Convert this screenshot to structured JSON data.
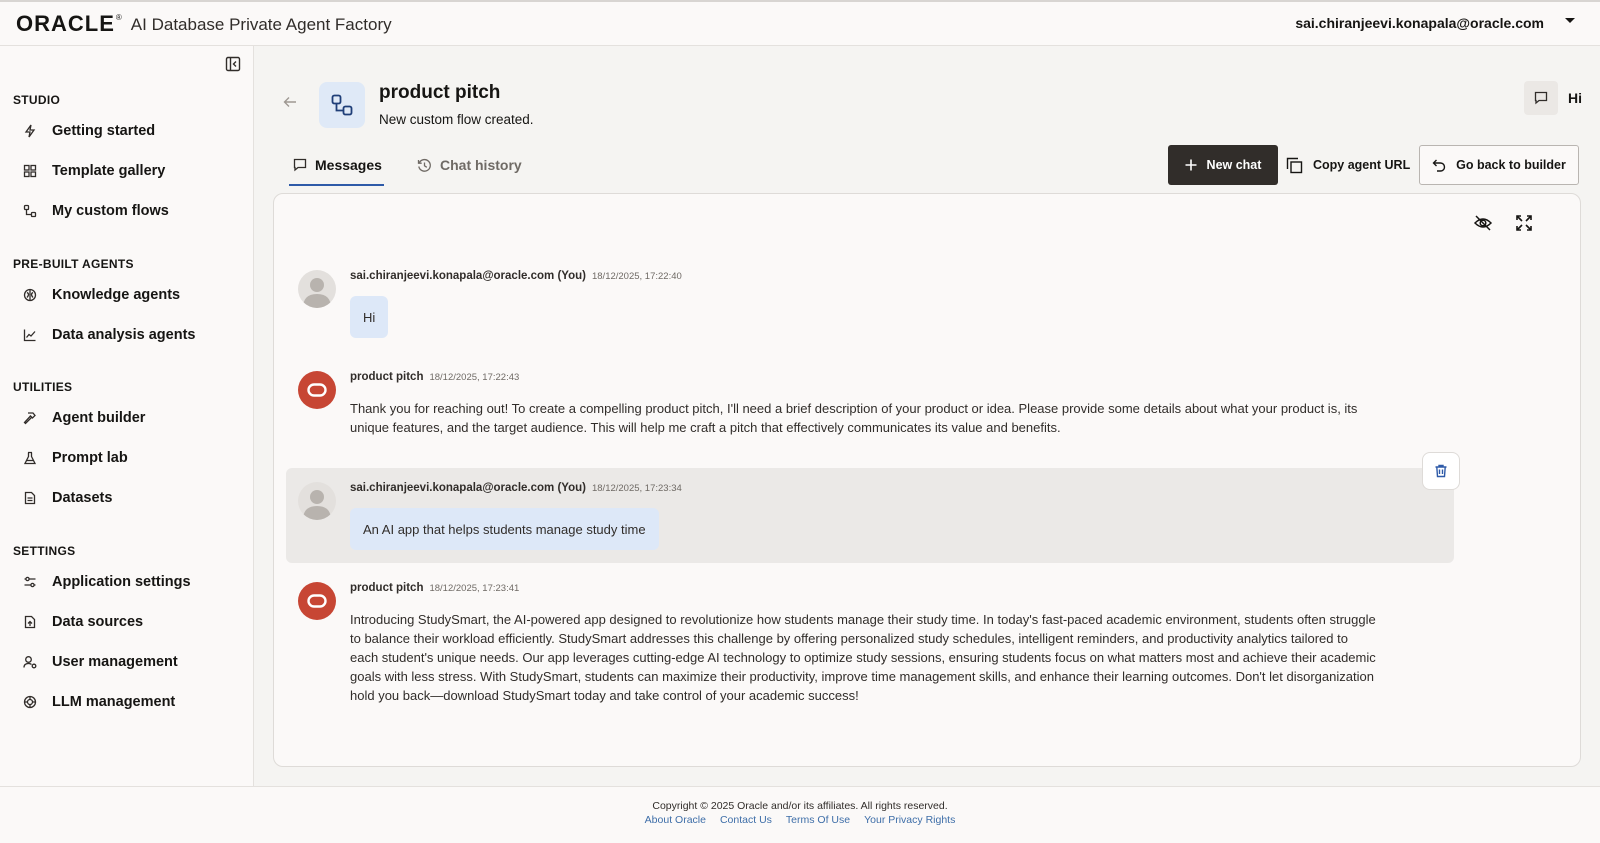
{
  "header": {
    "logo_text": "ORACLE",
    "logo_mark": "®",
    "product_name": "AI Database Private Agent Factory",
    "user_email": "sai.chiranjeevi.konapala@oracle.com"
  },
  "sidebar": {
    "sections": [
      {
        "title": "STUDIO",
        "items": [
          {
            "label": "Getting started",
            "icon": "bolt-icon"
          },
          {
            "label": "Template gallery",
            "icon": "grid-icon"
          },
          {
            "label": "My custom flows",
            "icon": "flow-icon"
          }
        ]
      },
      {
        "title": "PRE-BUILT AGENTS",
        "items": [
          {
            "label": "Knowledge agents",
            "icon": "brain-icon"
          },
          {
            "label": "Data analysis agents",
            "icon": "chart-line-icon"
          }
        ]
      },
      {
        "title": "UTILITIES",
        "items": [
          {
            "label": "Agent builder",
            "icon": "hammer-icon"
          },
          {
            "label": "Prompt lab",
            "icon": "flask-icon"
          },
          {
            "label": "Datasets",
            "icon": "document-icon"
          }
        ]
      },
      {
        "title": "SETTINGS",
        "items": [
          {
            "label": "Application settings",
            "icon": "sliders-icon"
          },
          {
            "label": "Data sources",
            "icon": "file-link-icon"
          },
          {
            "label": "User management",
            "icon": "user-gear-icon"
          },
          {
            "label": "LLM management",
            "icon": "cog-brain-icon"
          }
        ]
      }
    ]
  },
  "main": {
    "title": "product pitch",
    "subtitle": "New custom flow created.",
    "top_right_label": "Hi",
    "tabs": [
      {
        "label": "Messages",
        "active": true
      },
      {
        "label": "Chat history",
        "active": false
      }
    ],
    "actions": {
      "new_chat": "New chat",
      "copy_url": "Copy agent URL",
      "back_builder": "Go back to builder"
    }
  },
  "messages": [
    {
      "author": "sai.chiranjeevi.konapala@oracle.com (You)",
      "timestamp": "18/12/2025, 17:22:40",
      "role": "user",
      "text": "Hi"
    },
    {
      "author": "product pitch",
      "timestamp": "18/12/2025, 17:22:43",
      "role": "agent",
      "text": "Thank you for reaching out! To create a compelling product pitch, I'll need a brief description of your product or idea. Please provide some details about what your product is, its unique features, and the target audience. This will help me craft a pitch that effectively communicates its value and benefits."
    },
    {
      "author": "sai.chiranjeevi.konapala@oracle.com (You)",
      "timestamp": "18/12/2025, 17:23:34",
      "role": "user",
      "text": "An AI app that helps students manage study time"
    },
    {
      "author": "product pitch",
      "timestamp": "18/12/2025, 17:23:41",
      "role": "agent",
      "text": "Introducing StudySmart, the AI-powered app designed to revolutionize how students manage their study time. In today's fast-paced academic environment, students often struggle to balance their workload efficiently. StudySmart addresses this challenge by offering personalized study schedules, intelligent reminders, and productivity analytics tailored to each student's unique needs. Our app leverages cutting-edge AI technology to optimize study sessions, ensuring students focus on what matters most and achieve their academic goals with less stress. With StudySmart, students can maximize their productivity, improve time management skills, and enhance their learning outcomes. Don't let disorganization hold you back—download StudySmart today and take control of your academic success!"
    }
  ],
  "footer": {
    "copyright": "Copyright © 2025 Oracle and/or its affiliates. All rights reserved.",
    "links": [
      "About Oracle",
      "Contact Us",
      "Terms Of Use",
      "Your Privacy Rights"
    ]
  },
  "colors": {
    "accent": "#2e5aa8",
    "bot_avatar": "#c74634",
    "user_bubble": "#dde8f8",
    "primary_button": "#312d2a"
  }
}
